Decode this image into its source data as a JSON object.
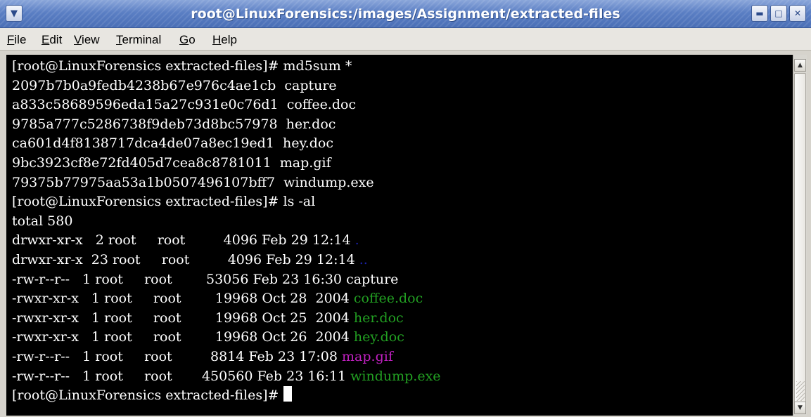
{
  "window": {
    "title": "root@LinuxForensics:/images/Assignment/extracted-files",
    "menu_icon": "chevron-down-icon",
    "controls": {
      "minimize": "minimize-icon",
      "maximize": "maximize-icon",
      "close": "close-icon"
    }
  },
  "menubar": {
    "items": [
      "File",
      "Edit",
      "View",
      "Terminal",
      "Go",
      "Help"
    ]
  },
  "colors": {
    "terminal_bg": "#000000",
    "terminal_fg": "#ffffff",
    "directory": "#1a22a8",
    "executable": "#22a022",
    "image": "#c020c0"
  },
  "terminal": {
    "lines": [
      {
        "text": "[root@LinuxForensics extracted-files]# md5sum *"
      },
      {
        "text": "2097b7b0a9fedb4238b67e976c4ae1cb  capture"
      },
      {
        "text": "a833c58689596eda15a27c931e0c76d1  coffee.doc"
      },
      {
        "text": "9785a777c5286738f9deb73d8bc57978  her.doc"
      },
      {
        "text": "ca601d4f8138717dca4de07a8ec19ed1  hey.doc"
      },
      {
        "text": "9bc3923cf8e72fd405d7cea8c8781011  map.gif"
      },
      {
        "text": "79375b77975aa53a1b0507496107bff7  windump.exe"
      },
      {
        "text": "[root@LinuxForensics extracted-files]# ls -al"
      },
      {
        "text": "total 580"
      },
      {
        "text": "drwxr-xr-x   2 root     root         4096 Feb 29 12:14 ",
        "name": ".",
        "kind": "directory"
      },
      {
        "text": "drwxr-xr-x  23 root     root         4096 Feb 29 12:14 ",
        "name": "..",
        "kind": "directory"
      },
      {
        "text": "-rw-r--r--   1 root     root        53056 Feb 23 16:30 ",
        "name": "capture",
        "kind": "regular"
      },
      {
        "text": "-rwxr-xr-x   1 root     root        19968 Oct 28  2004 ",
        "name": "coffee.doc",
        "kind": "executable"
      },
      {
        "text": "-rwxr-xr-x   1 root     root        19968 Oct 25  2004 ",
        "name": "her.doc",
        "kind": "executable"
      },
      {
        "text": "-rwxr-xr-x   1 root     root        19968 Oct 26  2004 ",
        "name": "hey.doc",
        "kind": "executable"
      },
      {
        "text": "-rw-r--r--   1 root     root         8814 Feb 23 17:08 ",
        "name": "map.gif",
        "kind": "image"
      },
      {
        "text": "-rw-r--r--   1 root     root       450560 Feb 23 16:11 ",
        "name": "windump.exe",
        "kind": "executable"
      },
      {
        "text": "[root@LinuxForensics extracted-files]# ",
        "cursor": true
      }
    ]
  },
  "scrollbar": {
    "up_icon": "scroll-up-arrow-icon",
    "down_icon": "scroll-down-arrow-icon"
  }
}
